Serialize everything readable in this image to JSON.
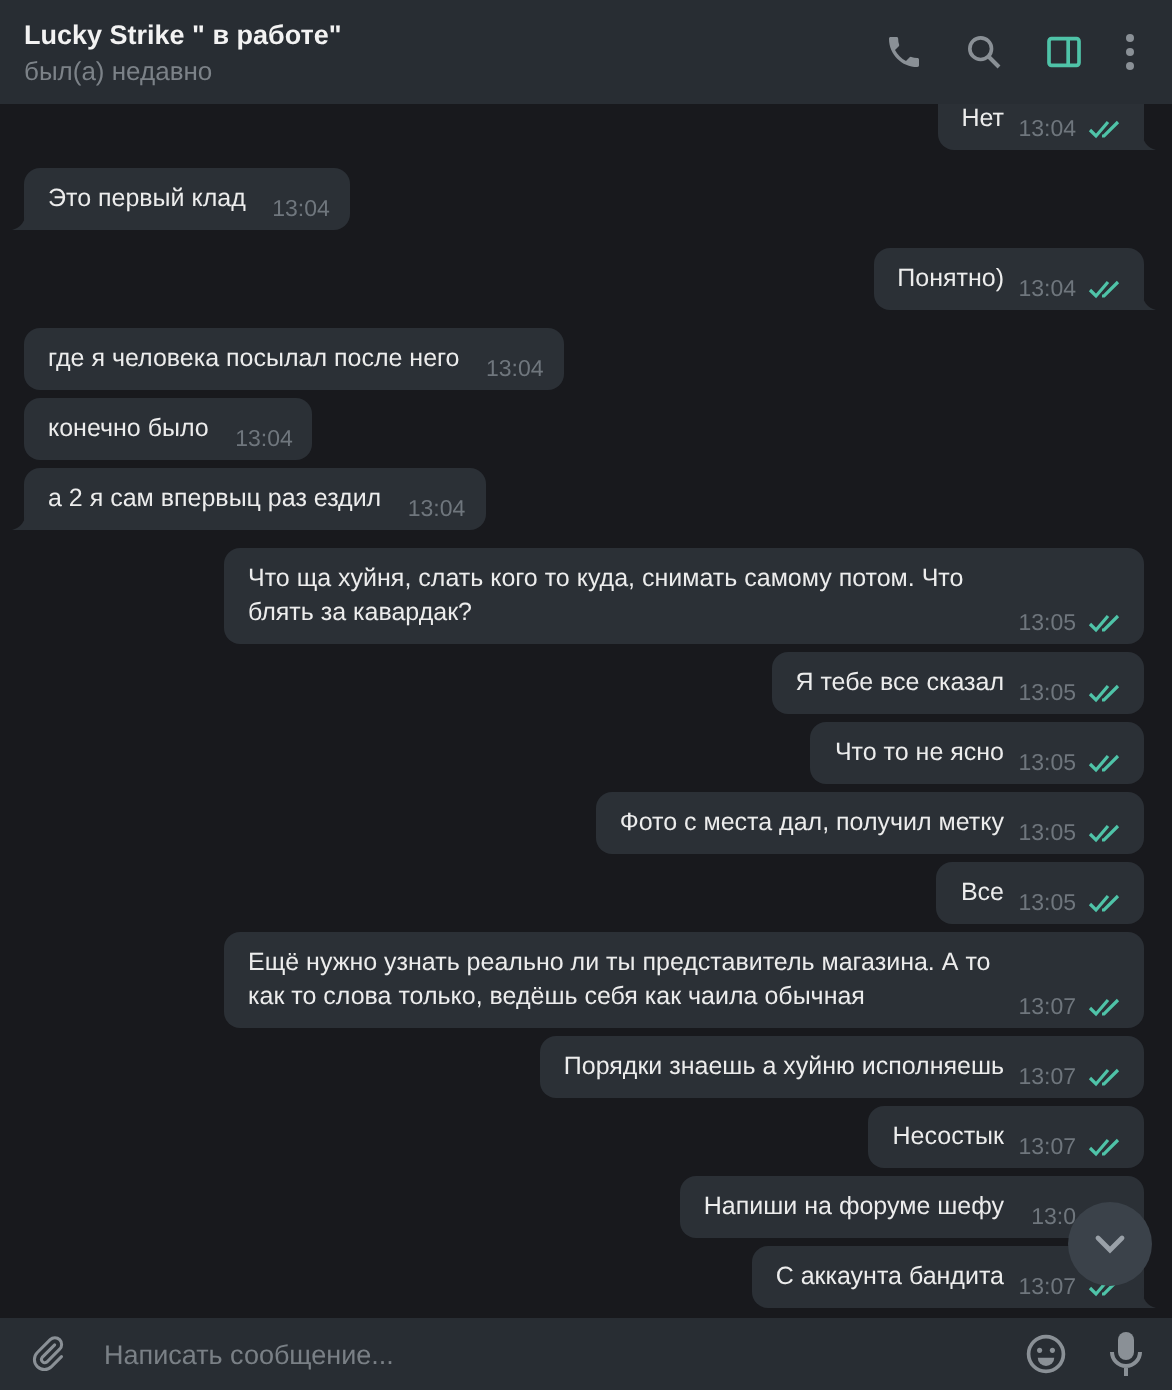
{
  "header": {
    "title": "Lucky Strike \" в работе\"",
    "status": "был(а) недавно",
    "sidebar_toggle_on": true
  },
  "messages": [
    {
      "kind": "outgoing",
      "text": "Нет",
      "time": "13:04",
      "read": true
    },
    {
      "kind": "incoming",
      "text": "Это первый клад",
      "time": "13:04"
    },
    {
      "kind": "outgoing",
      "text": "Понятно)",
      "time": "13:04",
      "read": true
    },
    {
      "kind": "incoming",
      "text": "где я человека посылал после него",
      "time": "13:04"
    },
    {
      "kind": "incoming",
      "text": "конечно было",
      "time": "13:04"
    },
    {
      "kind": "incoming",
      "text": "а 2 я сам впервыц раз ездил",
      "time": "13:04"
    },
    {
      "kind": "outgoing",
      "text": "Что ща хуйня, слать кого то куда, снимать самому потом. Что блять за кавардак?",
      "time": "13:05",
      "read": true
    },
    {
      "kind": "outgoing",
      "text": "Я тебе все сказал",
      "time": "13:05",
      "read": true
    },
    {
      "kind": "outgoing",
      "text": "Что то не ясно",
      "time": "13:05",
      "read": true
    },
    {
      "kind": "outgoing",
      "text": "Фото с места дал, получил метку",
      "time": "13:05",
      "read": true
    },
    {
      "kind": "outgoing",
      "text": "Все",
      "time": "13:05",
      "read": true
    },
    {
      "kind": "outgoing",
      "text": "Ещё нужно узнать реально ли ты представитель магазина. А то как то слова только, ведёшь себя как чаила обычная",
      "time": "13:07",
      "read": true
    },
    {
      "kind": "outgoing",
      "text": "Порядки знаешь а хуйню исполняешь",
      "time": "13:07",
      "read": true
    },
    {
      "kind": "outgoing",
      "text": "Несостык",
      "time": "13:07",
      "read": true
    },
    {
      "kind": "outgoing",
      "text": "Напиши на форуме шефу",
      "time": "13:0"
    },
    {
      "kind": "outgoing",
      "text": "С аккаунта бандита",
      "time": "13:07",
      "read": true
    }
  ],
  "composer": {
    "placeholder": "Написать сообщение..."
  }
}
